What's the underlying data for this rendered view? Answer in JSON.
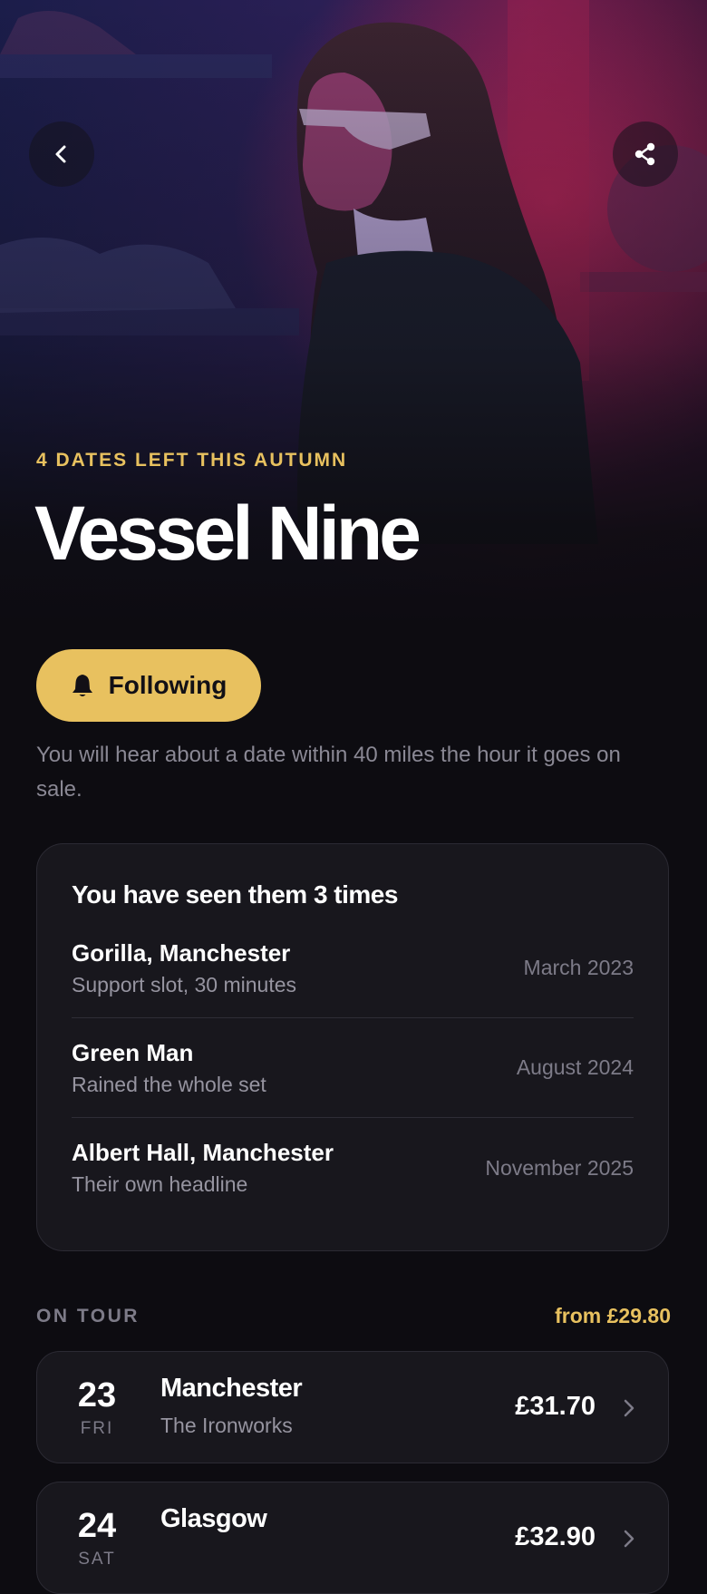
{
  "hero": {
    "eyebrow": "4 DATES LEFT THIS AUTUMN",
    "title": "Vessel Nine",
    "back_icon": "chevron-left-icon",
    "share_icon": "share-icon"
  },
  "follow": {
    "label": "Following",
    "icon": "bell-icon",
    "note": "You will hear about a date within 40 miles the hour it goes on sale."
  },
  "seen": {
    "title": "You have seen them 3 times",
    "items": [
      {
        "venue": "Gorilla, Manchester",
        "note": "Support slot, 30 minutes",
        "date": "March 2023"
      },
      {
        "venue": "Green Man",
        "note": "Rained the whole set",
        "date": "August 2024"
      },
      {
        "venue": "Albert Hall, Manchester",
        "note": "Their own headline",
        "date": "November 2025"
      }
    ]
  },
  "tour": {
    "label": "ON TOUR",
    "from": "from £29.80",
    "dates": [
      {
        "day": "23",
        "weekday": "FRI",
        "city": "Manchester",
        "venue": "The Ironworks",
        "price": "£31.70"
      },
      {
        "day": "24",
        "weekday": "SAT",
        "city": "Glasgow",
        "venue": "",
        "price": "£32.90"
      }
    ]
  },
  "colors": {
    "accent": "#e8c15f",
    "background": "#0d0c11",
    "card": "#18171d",
    "muted": "#8a8894"
  }
}
